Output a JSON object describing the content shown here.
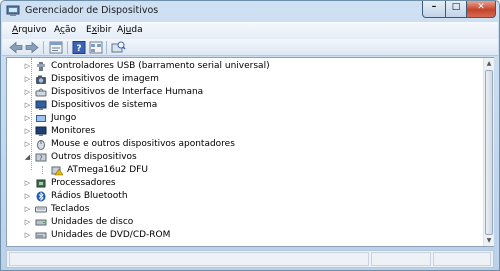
{
  "window": {
    "title": "Gerenciador de Dispositivos",
    "controls": {
      "minimize": "–",
      "maximize": "□",
      "close": "✕"
    }
  },
  "menu": {
    "items": [
      {
        "prefix": "",
        "key": "A",
        "rest": "rquivo"
      },
      {
        "prefix": "A",
        "key": "ç",
        "rest": "ão"
      },
      {
        "prefix": "E",
        "key": "x",
        "rest": "ibir"
      },
      {
        "prefix": "Aj",
        "key": "u",
        "rest": "da"
      }
    ]
  },
  "toolbar": {
    "buttons": [
      "back-icon",
      "forward-icon",
      "properties-icon",
      "help-icon",
      "view-icon",
      "scan-hardware-icon"
    ]
  },
  "tree": {
    "items": [
      {
        "label": "Controladores USB (barramento serial universal)",
        "icon": "usb-icon",
        "state": "collapsed",
        "level": 0
      },
      {
        "label": "Dispositivos de imagem",
        "icon": "camera-icon",
        "state": "collapsed",
        "level": 0
      },
      {
        "label": "Dispositivos de Interface Humana",
        "icon": "hid-icon",
        "state": "collapsed",
        "level": 0
      },
      {
        "label": "Dispositivos de sistema",
        "icon": "system-icon",
        "state": "collapsed",
        "level": 0
      },
      {
        "label": "Jungo",
        "icon": "jungo-icon",
        "state": "collapsed",
        "level": 0
      },
      {
        "label": "Monitores",
        "icon": "monitor-icon",
        "state": "collapsed",
        "level": 0
      },
      {
        "label": "Mouse e outros dispositivos apontadores",
        "icon": "mouse-icon",
        "state": "collapsed",
        "level": 0
      },
      {
        "label": "Outros dispositivos",
        "icon": "unknown-device-icon",
        "state": "expanded",
        "level": 0
      },
      {
        "label": "ATmega16u2 DFU",
        "icon": "warning-device-icon",
        "state": "leaf",
        "level": 1
      },
      {
        "label": "Processadores",
        "icon": "processor-icon",
        "state": "collapsed",
        "level": 0
      },
      {
        "label": "Rádios Bluetooth",
        "icon": "bluetooth-icon",
        "state": "collapsed",
        "level": 0
      },
      {
        "label": "Teclados",
        "icon": "keyboard-icon",
        "state": "collapsed",
        "level": 0
      },
      {
        "label": "Unidades de disco",
        "icon": "disk-icon",
        "state": "collapsed",
        "level": 0
      },
      {
        "label": "Unidades de DVD/CD-ROM",
        "icon": "dvd-icon",
        "state": "collapsed",
        "level": 0
      }
    ]
  },
  "colors": {
    "titlebar": "#cfe0f3",
    "close_button": "#c5442b",
    "bluetooth": "#1e5bb8",
    "warning": "#e8b800"
  }
}
